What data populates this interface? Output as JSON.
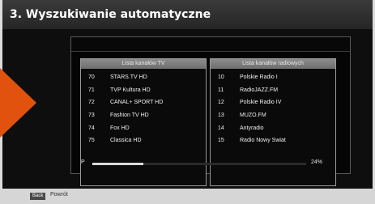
{
  "screen": {
    "title": "3. Wyszukiwanie automatyczne"
  },
  "tv_list": {
    "header": "Lista kanałów TV",
    "rows": [
      {
        "num": "70",
        "name": "STARS.TV HD"
      },
      {
        "num": "71",
        "name": "TVP Kultura HD"
      },
      {
        "num": "72",
        "name": "CANAL+ SPORT HD"
      },
      {
        "num": "73",
        "name": "Fashion TV HD"
      },
      {
        "num": "74",
        "name": "Fox HD"
      },
      {
        "num": "75",
        "name": "Classica HD"
      }
    ]
  },
  "radio_list": {
    "header": "Lista kanałów radiowych",
    "rows": [
      {
        "num": "10",
        "name": "Polskie Radio I"
      },
      {
        "num": "11",
        "name": "RadioJAZZ.FM"
      },
      {
        "num": "12",
        "name": "Polskie Radio IV"
      },
      {
        "num": "13",
        "name": "MUZO.FM"
      },
      {
        "num": "14",
        "name": "Antyradio"
      },
      {
        "num": "15",
        "name": "Radio Nowy Swiat"
      }
    ]
  },
  "progress": {
    "label": "P",
    "fraction": 0.24,
    "value_text": "24%"
  },
  "footer": {
    "back_key": "Back",
    "back_label": "Powrót"
  },
  "colors": {
    "accent_arrow": "#e2520f",
    "screen_background": "#0e0e0e",
    "list_header": "#8c8c8c"
  },
  "icons": {
    "pointer": "orange-arrow-icon"
  }
}
